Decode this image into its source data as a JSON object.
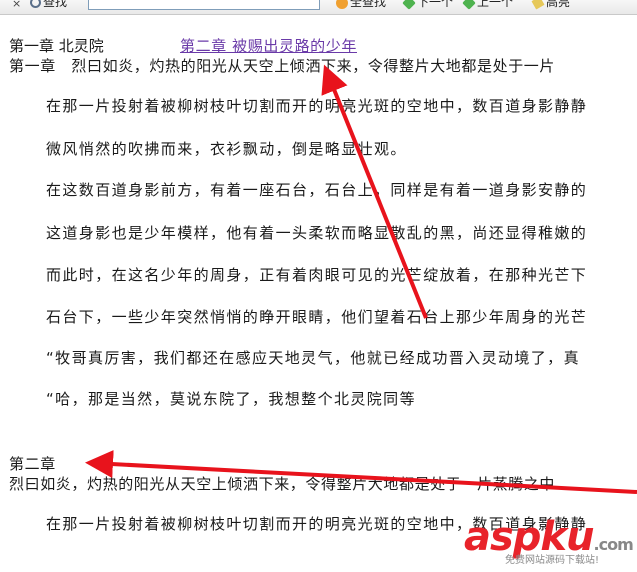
{
  "toolbar": {
    "close_glyph": "×",
    "find_label": "查找",
    "find_all_label": "全查找",
    "next_label": "下一个",
    "prev_label": "上一个",
    "highlight_label": "高亮"
  },
  "document": {
    "header_left": "第一章  北灵院",
    "header_link": "第二章  被赐出灵路的少年",
    "lines": [
      "第一章　烈曰如炎，灼热的阳光从天空上倾洒下来，令得整片大地都是处于一片",
      "在那一片投射着被柳树枝叶切割而开的明亮光斑的空地中，数百道身影静静",
      "微风悄然的吹拂而来，衣衫飘动，倒是略显壮观。",
      "在这数百道身影前方，有着一座石台，石台上，同样是有着一道身影安静的",
      "这道身影也是少年模样，他有着一头柔软而略显散乱的黑，尚还显得稚嫩的",
      "而此时，在这名少年的周身，正有着肉眼可见的光芒绽放着，在那种光芒下",
      "石台下，一些少年突然悄悄的睁开眼睛，他们望着石台上那少年周身的光芒",
      "“牧哥真厉害，我们都还在感应天地灵气，他就已经成功晋入灵动境了，真",
      "“哈，那是当然，莫说东院了，我想整个北灵院同等",
      "第二章",
      "烈曰如炎，灼热的阳光从天空上倾洒下来，令得整片大地都是处于一片蒸腾之中",
      "在那一片投射着被柳树枝叶切割而开的明亮光斑的空地中，数百道身影静静"
    ]
  },
  "annotation": {
    "arrow_color": "#e8131c"
  },
  "watermark": {
    "main": "aspku",
    "tld": ".com",
    "sub": "免费网站源码下载站!"
  }
}
